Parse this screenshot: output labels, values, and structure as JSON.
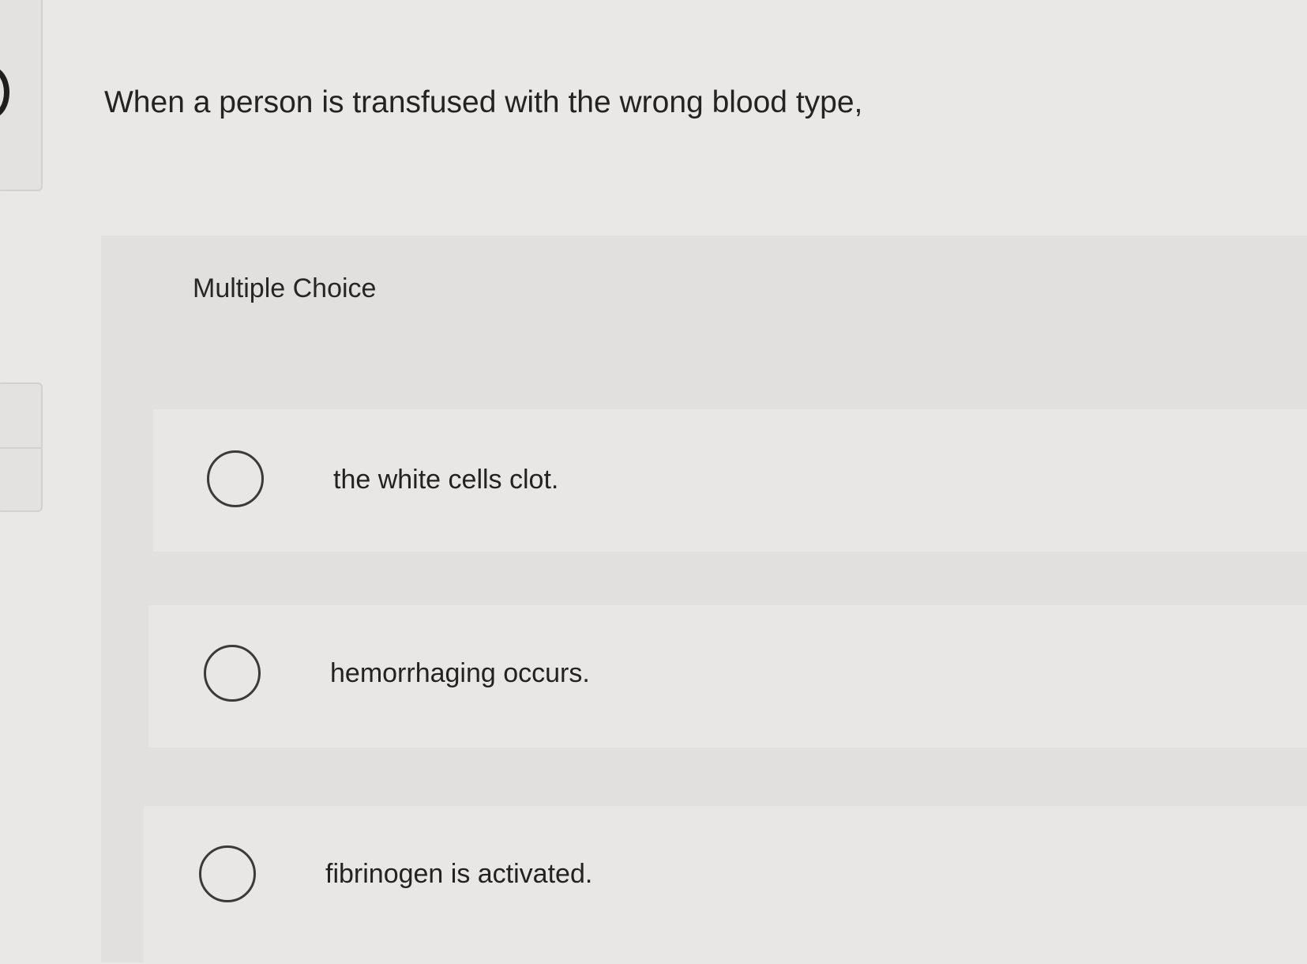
{
  "question": {
    "text": "When a person is transfused with the wrong blood type,"
  },
  "multiple_choice": {
    "label": "Multiple Choice",
    "options": [
      {
        "label": "the white cells clot.",
        "selected": false
      },
      {
        "label": "hemorrhaging occurs.",
        "selected": false
      },
      {
        "label": "fibrinogen is activated.",
        "selected": false
      }
    ]
  }
}
